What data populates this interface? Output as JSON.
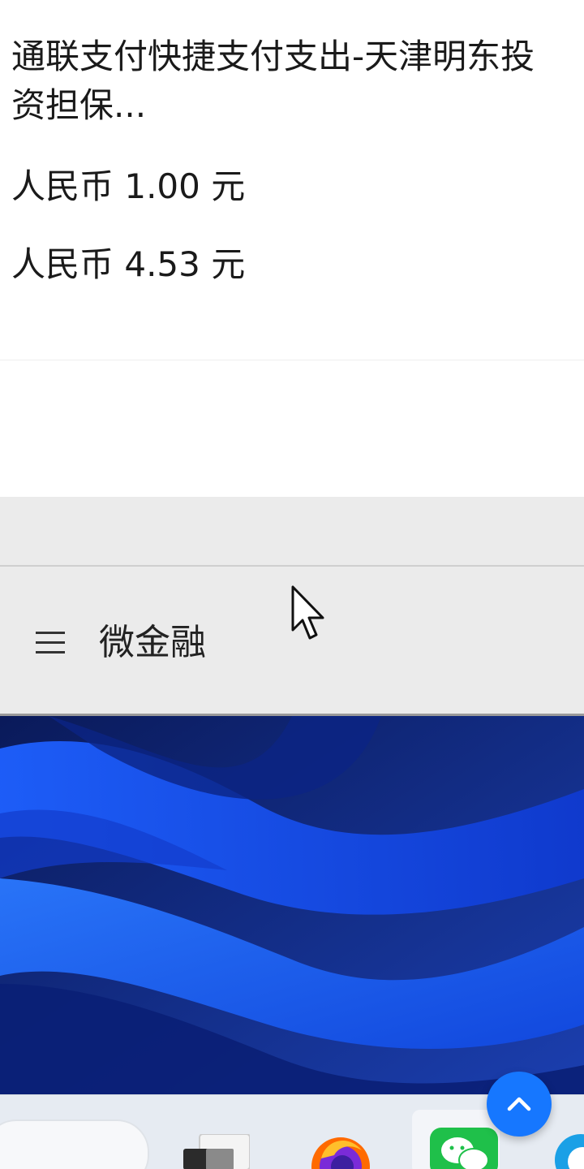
{
  "transaction": {
    "description_line1": "通联支付快捷支付支出-天津明东投",
    "description_line2": "资担保...",
    "amount_1": "人民币 1.00 元",
    "amount_2": "人民币 4.53 元"
  },
  "app_header": {
    "title": "微金融",
    "menu_icon": "hamburger-icon"
  },
  "taskbar": {
    "icons": [
      "task-view-icon",
      "firefox-icon",
      "wechat-icon",
      "edge-icon"
    ]
  },
  "fab": {
    "icon": "chevron-up-icon",
    "color": "#1677ff"
  },
  "colors": {
    "header_bg": "#ebebeb",
    "accent": "#1677ff",
    "wallpaper_blue": "#1a4fd8"
  }
}
